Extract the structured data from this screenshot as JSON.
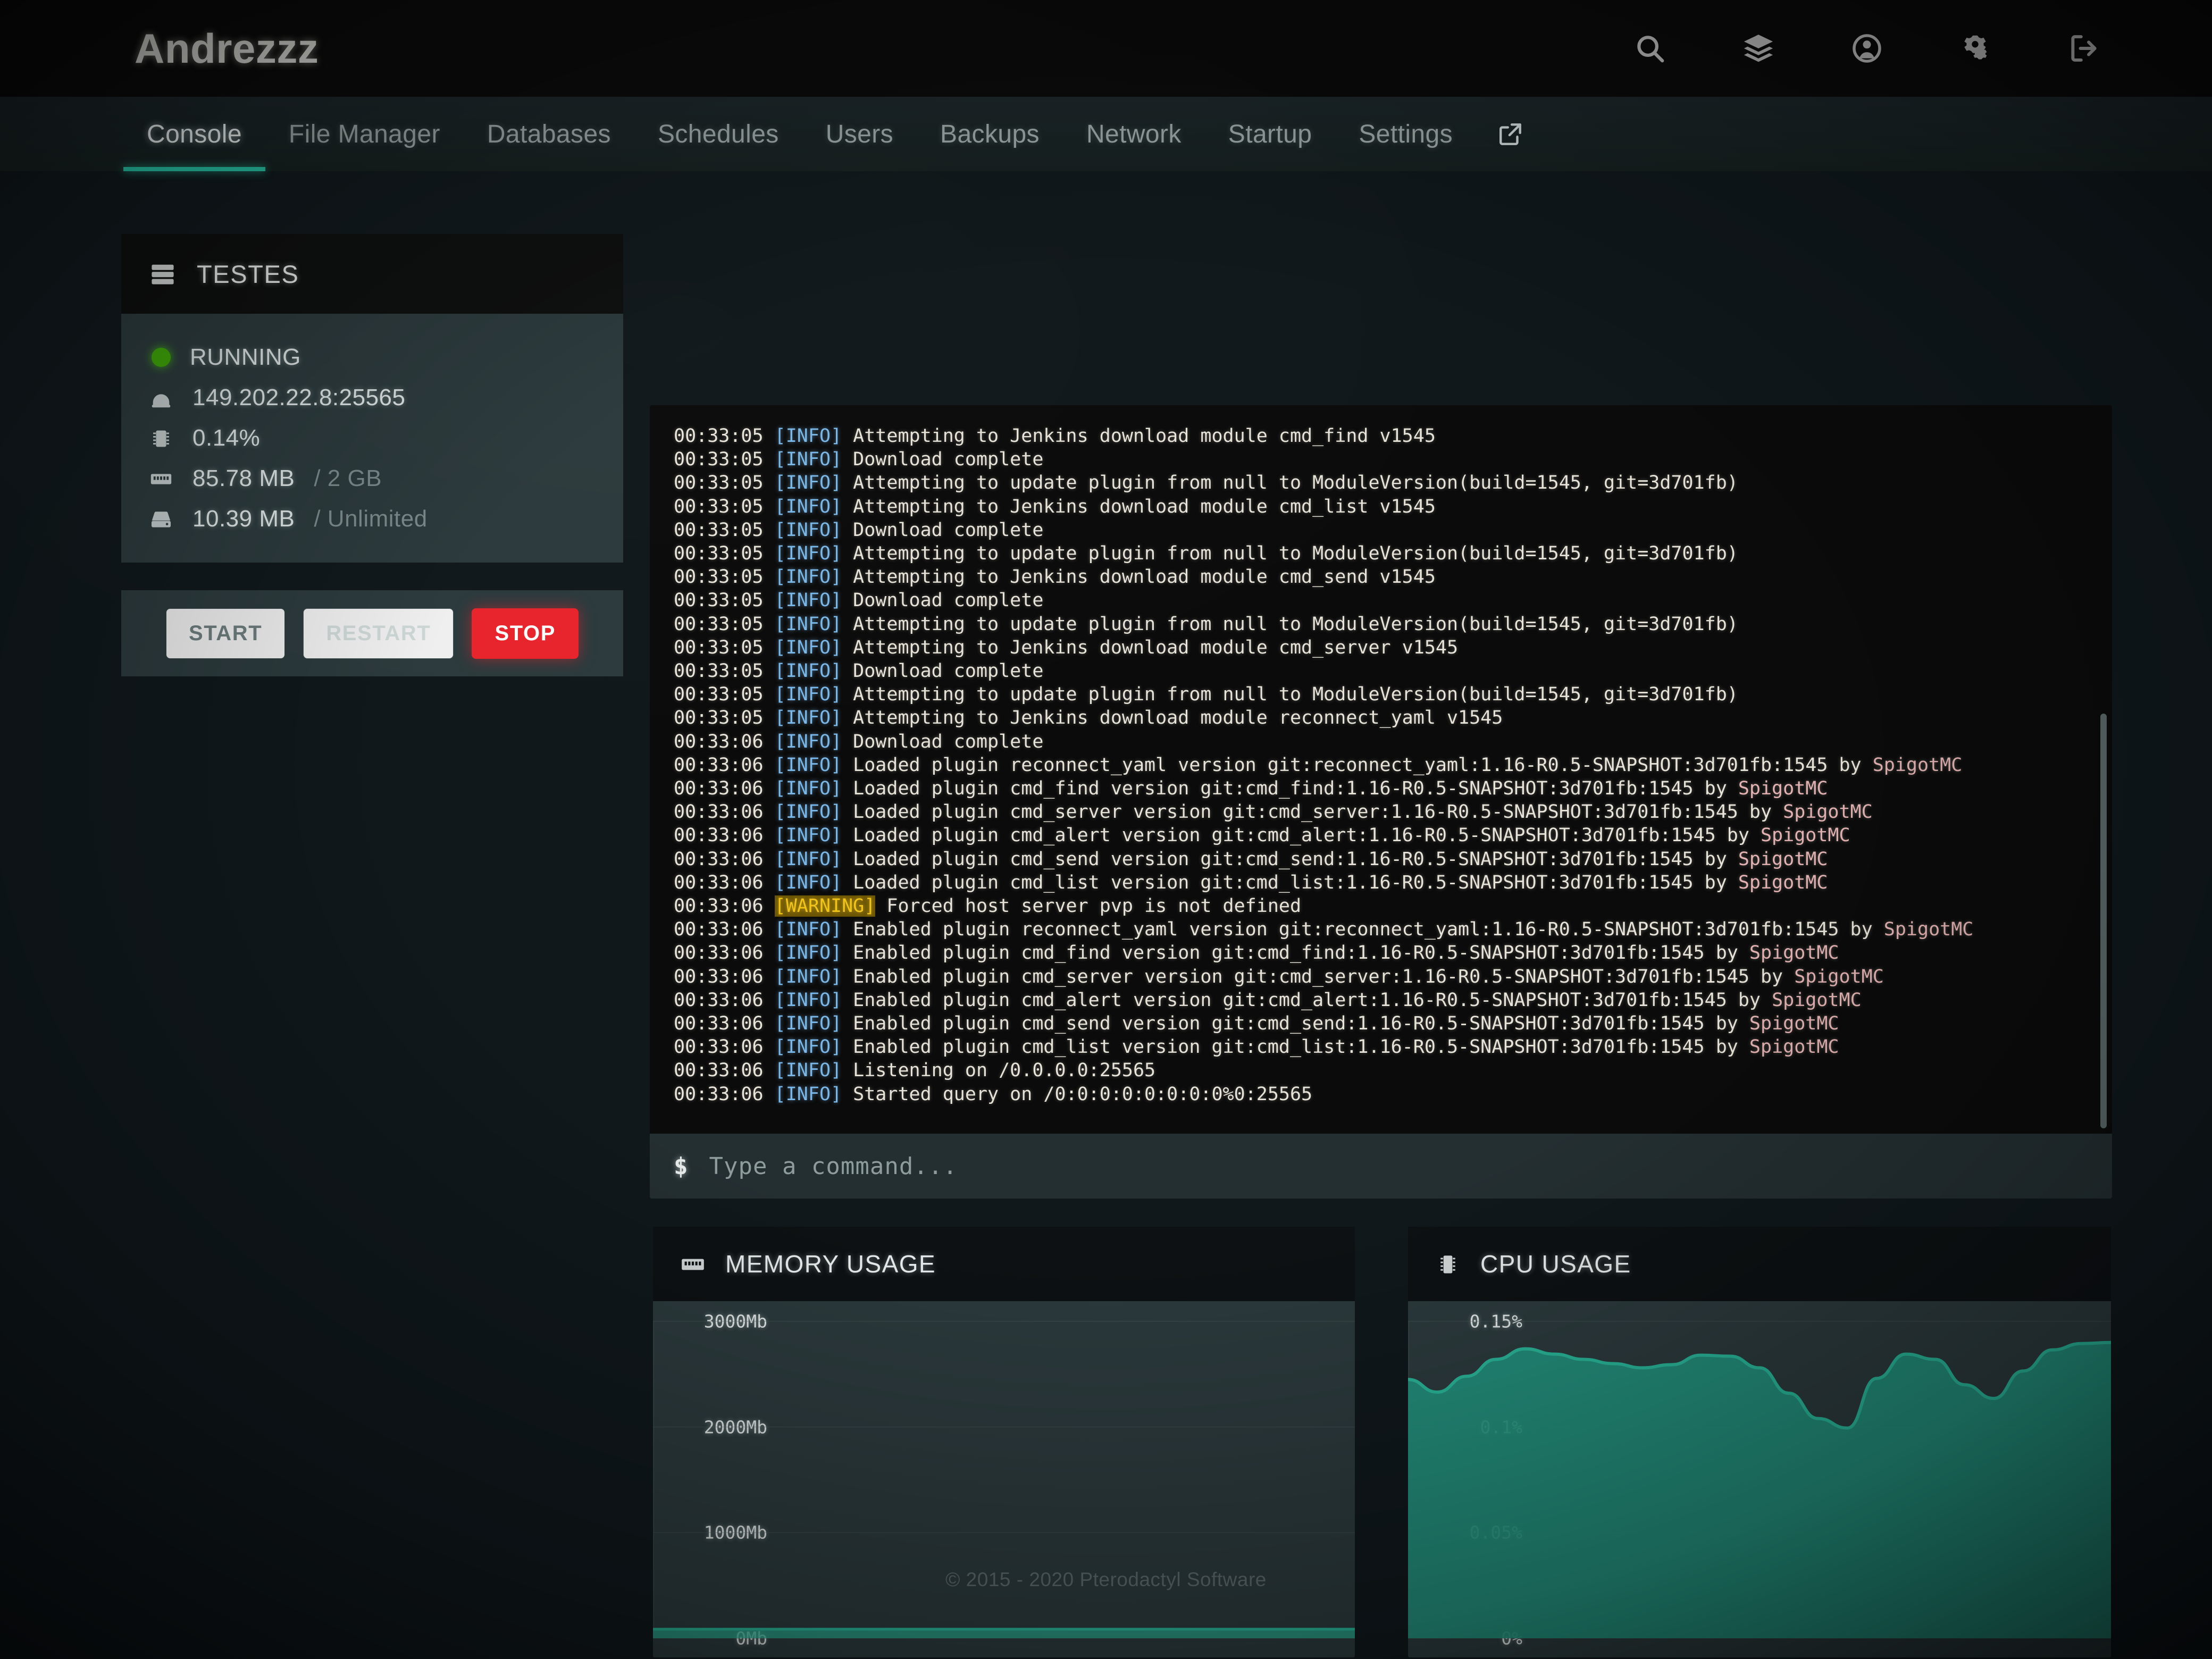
{
  "header": {
    "brand": "Andrezzz",
    "icons": [
      {
        "name": "search-icon"
      },
      {
        "name": "layers-icon"
      },
      {
        "name": "user-circle-icon"
      },
      {
        "name": "cogs-icon"
      },
      {
        "name": "logout-icon"
      }
    ]
  },
  "tabs": [
    {
      "label": "Console",
      "active": true
    },
    {
      "label": "File Manager",
      "active": false
    },
    {
      "label": "Databases",
      "active": false
    },
    {
      "label": "Schedules",
      "active": false
    },
    {
      "label": "Users",
      "active": false
    },
    {
      "label": "Backups",
      "active": false
    },
    {
      "label": "Network",
      "active": false
    },
    {
      "label": "Startup",
      "active": false
    },
    {
      "label": "Settings",
      "active": false
    }
  ],
  "tab_external_icon": "external-link-icon",
  "server": {
    "name": "TESTES",
    "status": "RUNNING",
    "status_color": "#3ea908",
    "address": "149.202.22.8:25565",
    "cpu": "0.14%",
    "memory_used": "85.78 MB",
    "memory_limit": "/ 2 GB",
    "disk_used": "10.39 MB",
    "disk_limit": "/ Unlimited",
    "buttons": {
      "start": "START",
      "restart": "RESTART",
      "stop": "STOP",
      "stop_color": "#e8232b"
    }
  },
  "console": {
    "prompt": "$",
    "input_value": "",
    "input_placeholder": "Type a command...",
    "lines": [
      {
        "ts": "00:33:05",
        "level": "INFO",
        "msg": "Attempting to Jenkins download module cmd_find v1545"
      },
      {
        "ts": "00:33:05",
        "level": "INFO",
        "msg": "Download complete"
      },
      {
        "ts": "00:33:05",
        "level": "INFO",
        "msg": "Attempting to update plugin from null to ModuleVersion(build=1545, git=3d701fb)"
      },
      {
        "ts": "00:33:05",
        "level": "INFO",
        "msg": "Attempting to Jenkins download module cmd_list v1545"
      },
      {
        "ts": "00:33:05",
        "level": "INFO",
        "msg": "Download complete"
      },
      {
        "ts": "00:33:05",
        "level": "INFO",
        "msg": "Attempting to update plugin from null to ModuleVersion(build=1545, git=3d701fb)"
      },
      {
        "ts": "00:33:05",
        "level": "INFO",
        "msg": "Attempting to Jenkins download module cmd_send v1545"
      },
      {
        "ts": "00:33:05",
        "level": "INFO",
        "msg": "Download complete"
      },
      {
        "ts": "00:33:05",
        "level": "INFO",
        "msg": "Attempting to update plugin from null to ModuleVersion(build=1545, git=3d701fb)"
      },
      {
        "ts": "00:33:05",
        "level": "INFO",
        "msg": "Attempting to Jenkins download module cmd_server v1545"
      },
      {
        "ts": "00:33:05",
        "level": "INFO",
        "msg": "Download complete"
      },
      {
        "ts": "00:33:05",
        "level": "INFO",
        "msg": "Attempting to update plugin from null to ModuleVersion(build=1545, git=3d701fb)"
      },
      {
        "ts": "00:33:05",
        "level": "INFO",
        "msg": "Attempting to Jenkins download module reconnect_yaml v1545"
      },
      {
        "ts": "00:33:06",
        "level": "INFO",
        "msg": "Download complete"
      },
      {
        "ts": "00:33:06",
        "level": "INFO",
        "msg": "Loaded plugin reconnect_yaml version git:reconnect_yaml:1.16-R0.5-SNAPSHOT:3d701fb:1545 by ",
        "by": "SpigotMC"
      },
      {
        "ts": "00:33:06",
        "level": "INFO",
        "msg": "Loaded plugin cmd_find version git:cmd_find:1.16-R0.5-SNAPSHOT:3d701fb:1545 by ",
        "by": "SpigotMC"
      },
      {
        "ts": "00:33:06",
        "level": "INFO",
        "msg": "Loaded plugin cmd_server version git:cmd_server:1.16-R0.5-SNAPSHOT:3d701fb:1545 by ",
        "by": "SpigotMC"
      },
      {
        "ts": "00:33:06",
        "level": "INFO",
        "msg": "Loaded plugin cmd_alert version git:cmd_alert:1.16-R0.5-SNAPSHOT:3d701fb:1545 by ",
        "by": "SpigotMC"
      },
      {
        "ts": "00:33:06",
        "level": "INFO",
        "msg": "Loaded plugin cmd_send version git:cmd_send:1.16-R0.5-SNAPSHOT:3d701fb:1545 by ",
        "by": "SpigotMC"
      },
      {
        "ts": "00:33:06",
        "level": "INFO",
        "msg": "Loaded plugin cmd_list version git:cmd_list:1.16-R0.5-SNAPSHOT:3d701fb:1545 by ",
        "by": "SpigotMC"
      },
      {
        "ts": "00:33:06",
        "level": "WARNING",
        "msg": "Forced host server pvp is not defined"
      },
      {
        "ts": "00:33:06",
        "level": "INFO",
        "msg": "Enabled plugin reconnect_yaml version git:reconnect_yaml:1.16-R0.5-SNAPSHOT:3d701fb:1545 by ",
        "by": "SpigotMC"
      },
      {
        "ts": "00:33:06",
        "level": "INFO",
        "msg": "Enabled plugin cmd_find version git:cmd_find:1.16-R0.5-SNAPSHOT:3d701fb:1545 by ",
        "by": "SpigotMC"
      },
      {
        "ts": "00:33:06",
        "level": "INFO",
        "msg": "Enabled plugin cmd_server version git:cmd_server:1.16-R0.5-SNAPSHOT:3d701fb:1545 by ",
        "by": "SpigotMC"
      },
      {
        "ts": "00:33:06",
        "level": "INFO",
        "msg": "Enabled plugin cmd_alert version git:cmd_alert:1.16-R0.5-SNAPSHOT:3d701fb:1545 by ",
        "by": "SpigotMC"
      },
      {
        "ts": "00:33:06",
        "level": "INFO",
        "msg": "Enabled plugin cmd_send version git:cmd_send:1.16-R0.5-SNAPSHOT:3d701fb:1545 by ",
        "by": "SpigotMC"
      },
      {
        "ts": "00:33:06",
        "level": "INFO",
        "msg": "Enabled plugin cmd_list version git:cmd_list:1.16-R0.5-SNAPSHOT:3d701fb:1545 by ",
        "by": "SpigotMC"
      },
      {
        "ts": "00:33:06",
        "level": "INFO",
        "msg": "Listening on /0.0.0.0:25565"
      },
      {
        "ts": "00:33:06",
        "level": "INFO",
        "msg": "Started query on /0:0:0:0:0:0:0:0%0:25565"
      }
    ]
  },
  "chart_data": [
    {
      "type": "area",
      "title": "MEMORY USAGE",
      "icon": "memory-chip-icon",
      "ylabel": "",
      "xlabel": "",
      "ytick_labels": [
        "3000Mb",
        "2000Mb",
        "1000Mb",
        "0Mb"
      ],
      "ytick_values": [
        3000,
        2000,
        1000,
        0
      ],
      "ylim": [
        0,
        3000
      ],
      "unit": "Mb",
      "grid": true,
      "legend": "none",
      "line_color": "#29b79a",
      "values": [
        86,
        86,
        86,
        86,
        86,
        86,
        86,
        86,
        86,
        86,
        86,
        86,
        86,
        86,
        86,
        86,
        86,
        86,
        86,
        86
      ]
    },
    {
      "type": "area",
      "title": "CPU USAGE",
      "icon": "cpu-chip-icon",
      "ylabel": "",
      "xlabel": "",
      "ytick_labels": [
        "0.15%",
        "0.1%",
        "0.05%",
        "0%"
      ],
      "ytick_values": [
        0.15,
        0.1,
        0.05,
        0
      ],
      "ylim": [
        0,
        0.15
      ],
      "unit": "%",
      "grid": true,
      "legend": "none",
      "line_color": "#29b79a",
      "values": [
        0.1225,
        0.1165,
        0.124,
        0.132,
        0.137,
        0.1345,
        0.132,
        0.13,
        0.128,
        0.1295,
        0.134,
        0.1335,
        0.128,
        0.116,
        0.104,
        0.0995,
        0.123,
        0.1345,
        0.132,
        0.12,
        0.1135,
        0.1265,
        0.1365,
        0.1395,
        0.14
      ]
    }
  ],
  "footer": {
    "copyright": "© 2015 - 2020 Pterodactyl Software"
  }
}
